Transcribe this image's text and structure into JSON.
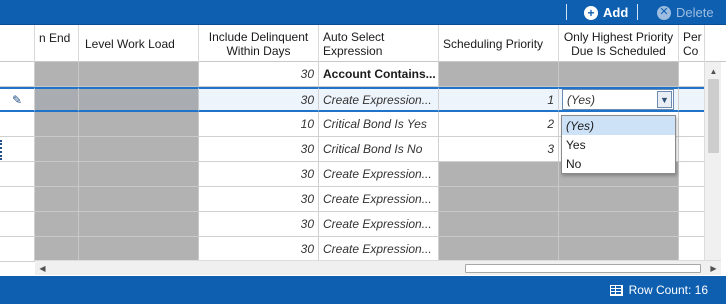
{
  "toolbar": {
    "add_label": "Add",
    "delete_label": "Delete"
  },
  "columns": [
    "n End",
    "Level Work Load",
    "Include Delinquent Within Days",
    "Auto Select Expression",
    "Scheduling Priority",
    "Only Highest Priority Due Is Scheduled",
    "Per Co"
  ],
  "rows": [
    {
      "days": "30",
      "expression": "Account Contains...",
      "priority": "",
      "highest": ""
    },
    {
      "days": "30",
      "expression": "Create Expression...",
      "priority": "1",
      "highest": "(Yes)"
    },
    {
      "days": "10",
      "expression": "Critical Bond Is Yes",
      "priority": "2",
      "highest": ""
    },
    {
      "days": "30",
      "expression": "Critical Bond Is No",
      "priority": "3",
      "highest": ""
    },
    {
      "days": "30",
      "expression": "Create Expression...",
      "priority": "",
      "highest": ""
    },
    {
      "days": "30",
      "expression": "Create Expression...",
      "priority": "",
      "highest": ""
    },
    {
      "days": "30",
      "expression": "Create Expression...",
      "priority": "",
      "highest": ""
    },
    {
      "days": "30",
      "expression": "Create Expression...",
      "priority": "",
      "highest": ""
    }
  ],
  "editor": {
    "value": "(Yes)",
    "options": [
      "(Yes)",
      "Yes",
      "No"
    ]
  },
  "status": {
    "row_count": "Row Count:  16"
  },
  "colors": {
    "accent": "#0e5fb0",
    "selection": "#1f73c8",
    "locked_cell": "#b2b2b2"
  },
  "icons": [
    "add-icon",
    "delete-icon",
    "edit-pencil-icon",
    "dropdown-chevron-icon",
    "row-count-grid-icon"
  ]
}
